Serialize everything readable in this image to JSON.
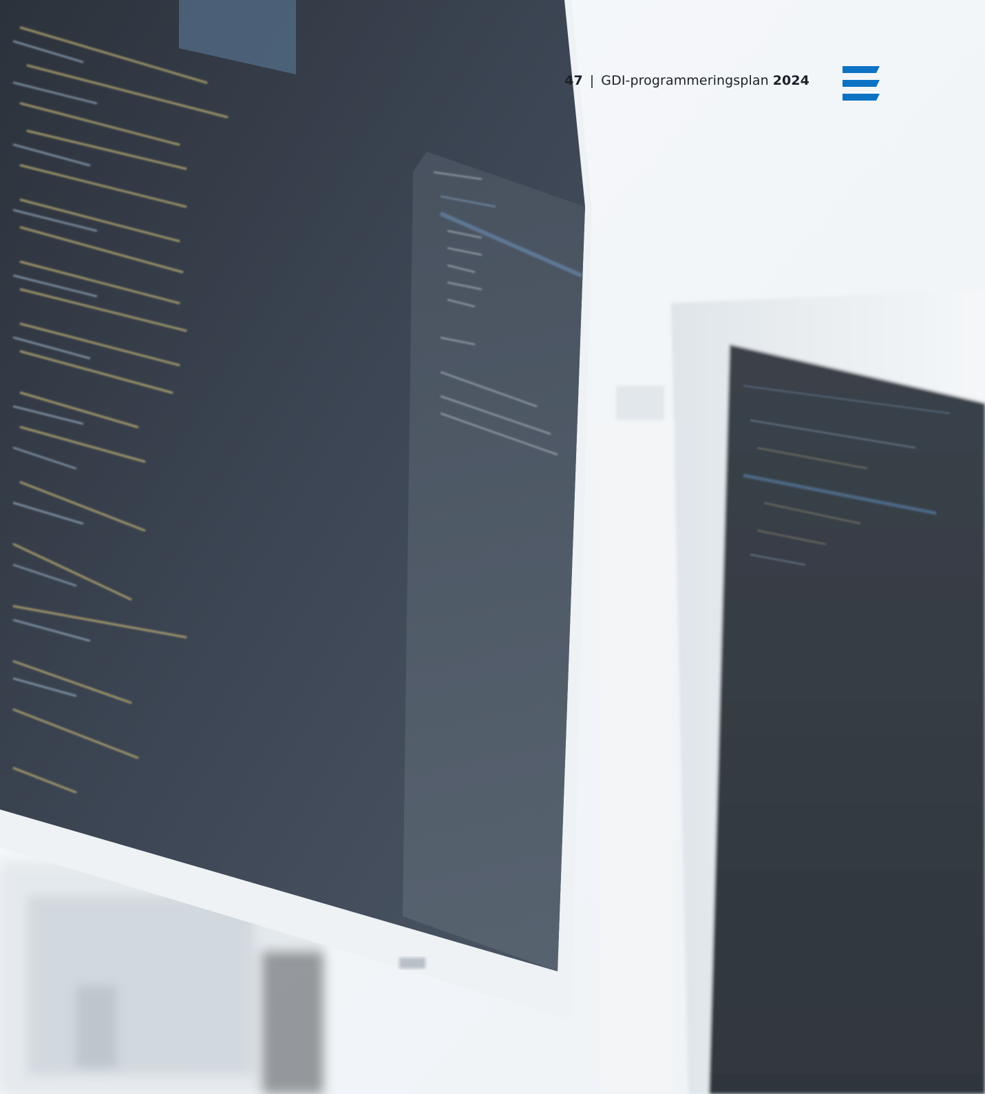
{
  "header": {
    "page_number": "47",
    "separator": "|",
    "document_title": "GDI-programmeringsplan",
    "year": "2024"
  },
  "photo": {
    "subject": "monitors-with-code"
  },
  "icons": {
    "menu": "hamburger-menu-icon"
  },
  "colors": {
    "brand_blue": "#0b72c4",
    "header_text": "#1a2028",
    "screen_dark": "#3a4350",
    "monitor_frame": "#e9eef2"
  }
}
